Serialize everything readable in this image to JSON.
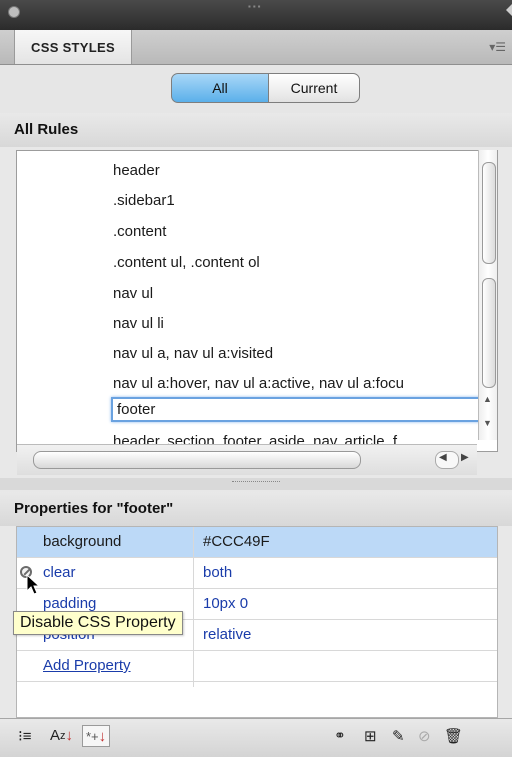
{
  "panel": {
    "tab_label": "CSS STYLES",
    "seg_all": "All",
    "seg_current": "Current"
  },
  "all_rules": {
    "title": "All Rules",
    "rules": [
      "header",
      ".sidebar1",
      ".content",
      ".content ul, .content ol",
      "nav ul",
      "nav ul li",
      "nav ul a, nav ul a:visited",
      "nav ul a:hover, nav ul a:active, nav ul a:focu",
      "footer",
      "header, section, footer, aside, nav, article, f"
    ],
    "selected_index": 8
  },
  "properties": {
    "title": "Properties for \"footer\"",
    "rows": [
      {
        "name": "background",
        "value": "#CCC49F"
      },
      {
        "name": "clear",
        "value": "both"
      },
      {
        "name": "padding",
        "value": "10px 0"
      },
      {
        "name": "position",
        "value": "relative"
      }
    ],
    "add_label": "Add Property",
    "tooltip": "Disable CSS Property"
  },
  "toolbar": {
    "icons": [
      "category-view-icon",
      "alpha-sort-icon",
      "set-properties-icon",
      "attach-stylesheet-icon",
      "new-rule-icon",
      "edit-rule-icon",
      "disable-icon",
      "delete-icon"
    ],
    "labels": {
      "category": "⁝≡",
      "alpha": "A",
      "alpha_z": "z",
      "set": "*+"
    }
  },
  "colors": {
    "selected_row": "#bcd9f7",
    "segment_active": "#5bb0ea",
    "tooltip_bg": "#ffffcc",
    "link": "#1a3caa"
  }
}
